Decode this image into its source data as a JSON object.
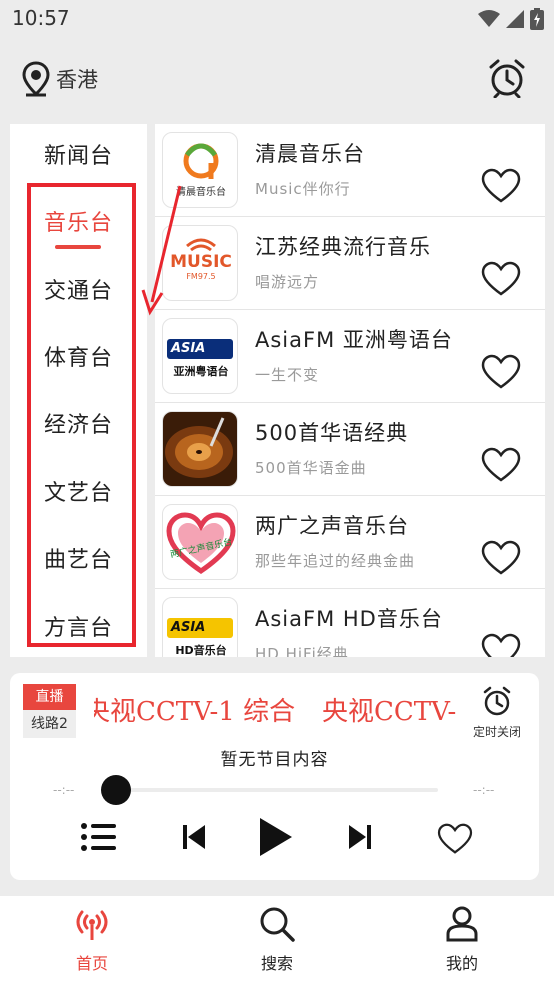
{
  "status": {
    "time": "10:57"
  },
  "header": {
    "location": "香港"
  },
  "categories": [
    {
      "label": "新闻台"
    },
    {
      "label": "音乐台"
    },
    {
      "label": "交通台"
    },
    {
      "label": "体育台"
    },
    {
      "label": "经济台"
    },
    {
      "label": "文艺台"
    },
    {
      "label": "曲艺台"
    },
    {
      "label": "方言台"
    }
  ],
  "stations": [
    {
      "name": "清晨音乐台",
      "subtitle": "Music伴你行",
      "logo_text": "清晨音乐台"
    },
    {
      "name": "江苏经典流行音乐",
      "subtitle": "唱游远方",
      "logo_text": "MUSIC",
      "logo_sub": "FM97.5"
    },
    {
      "name": "AsiaFM 亚洲粤语台",
      "subtitle": "一生不变",
      "logo_text": "ASIA",
      "logo_sub": "亚洲粤语台"
    },
    {
      "name": "500首华语经典",
      "subtitle": "500首华语金曲"
    },
    {
      "name": "两广之声音乐台",
      "subtitle": "那些年追过的经典金曲",
      "logo_text": "两广之声音乐台"
    },
    {
      "name": "AsiaFM HD音乐台",
      "subtitle": "HD HiFi经典",
      "logo_text": "ASIA",
      "logo_sub": "HD音乐台"
    }
  ],
  "player": {
    "live_badge": "直播",
    "line_label": "线路2",
    "marquee_text": "央视CCTV-1 综合",
    "timer_label": "定时关闭",
    "program": "暂无节目内容",
    "time_left": "--:--",
    "time_right": "--:--",
    "progress": 0
  },
  "nav": [
    {
      "label": "首页"
    },
    {
      "label": "搜索"
    },
    {
      "label": "我的"
    }
  ],
  "colors": {
    "accent": "#e8463e",
    "annotation": "#e8262e"
  }
}
